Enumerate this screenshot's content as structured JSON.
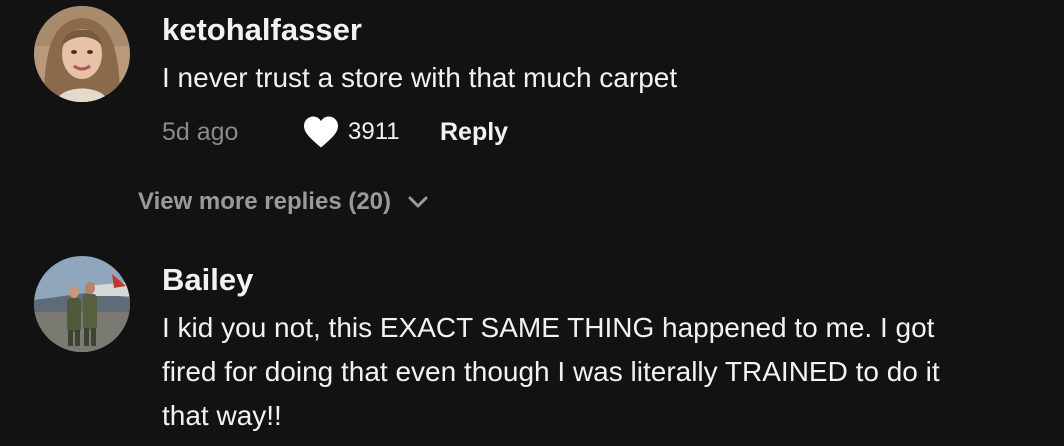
{
  "comments": [
    {
      "username": "ketohalfasser",
      "text_lines": [
        "I never trust a store with that much carpet"
      ],
      "timestamp": "5d ago",
      "likes": "3911",
      "reply_label": "Reply",
      "avatar_icon": "user-avatar-photo",
      "view_more": "View more replies (20)"
    },
    {
      "username": "Bailey",
      "text_lines": [
        "I kid you not, this EXACT SAME THING happened to me. I got",
        "fired for doing that even though I was literally TRAINED to do it",
        "that way!!"
      ],
      "avatar_icon": "user-avatar-photo"
    }
  ],
  "icons": {
    "like": "heart-icon",
    "expand": "chevron-down-icon"
  },
  "colors": {
    "background": "#121212",
    "primary_text": "#f2f2f2",
    "secondary_text": "#8a8a8a",
    "view_more_text": "#9a9a9a"
  }
}
